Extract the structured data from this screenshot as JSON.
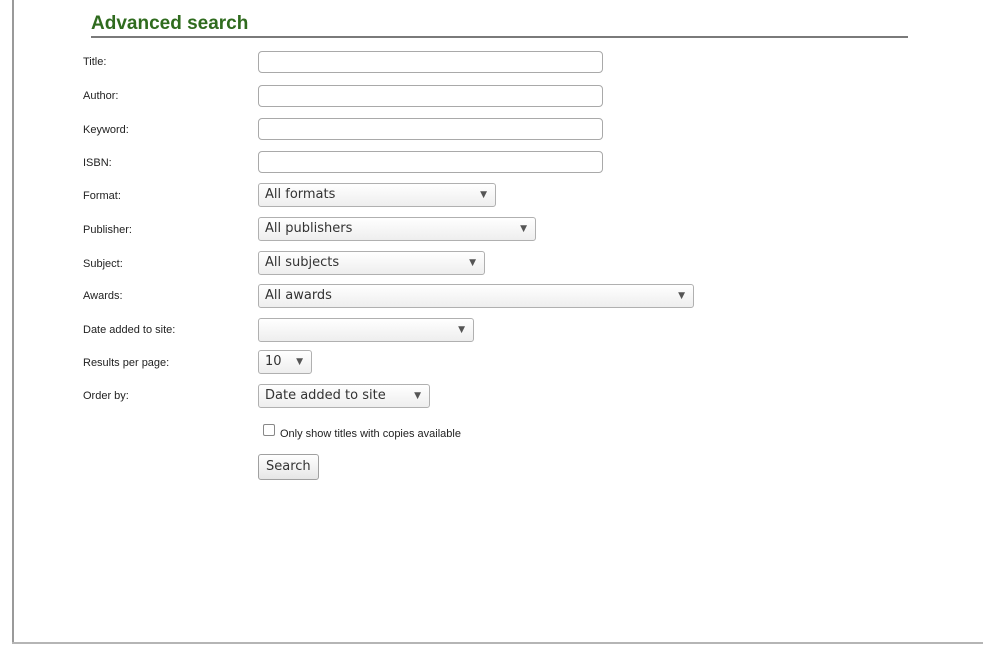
{
  "heading": "Advanced search",
  "fields": {
    "title": {
      "label": "Title:",
      "value": ""
    },
    "author": {
      "label": "Author:",
      "value": ""
    },
    "keyword": {
      "label": "Keyword:",
      "value": ""
    },
    "isbn": {
      "label": "ISBN:",
      "value": ""
    },
    "format": {
      "label": "Format:",
      "selected": "All formats"
    },
    "publisher": {
      "label": "Publisher:",
      "selected": "All publishers"
    },
    "subject": {
      "label": "Subject:",
      "selected": "All subjects"
    },
    "awards": {
      "label": "Awards:",
      "selected": "All awards"
    },
    "date_added": {
      "label": "Date added to site:",
      "selected": ""
    },
    "results_per_page": {
      "label": "Results per page:",
      "selected": "10"
    },
    "order_by": {
      "label": "Order by:",
      "selected": "Date added to site"
    }
  },
  "availability_checkbox": {
    "label": "Only show titles with copies available",
    "checked": false
  },
  "search_button": "Search",
  "icons": {
    "dropdown_arrow": "▼"
  }
}
